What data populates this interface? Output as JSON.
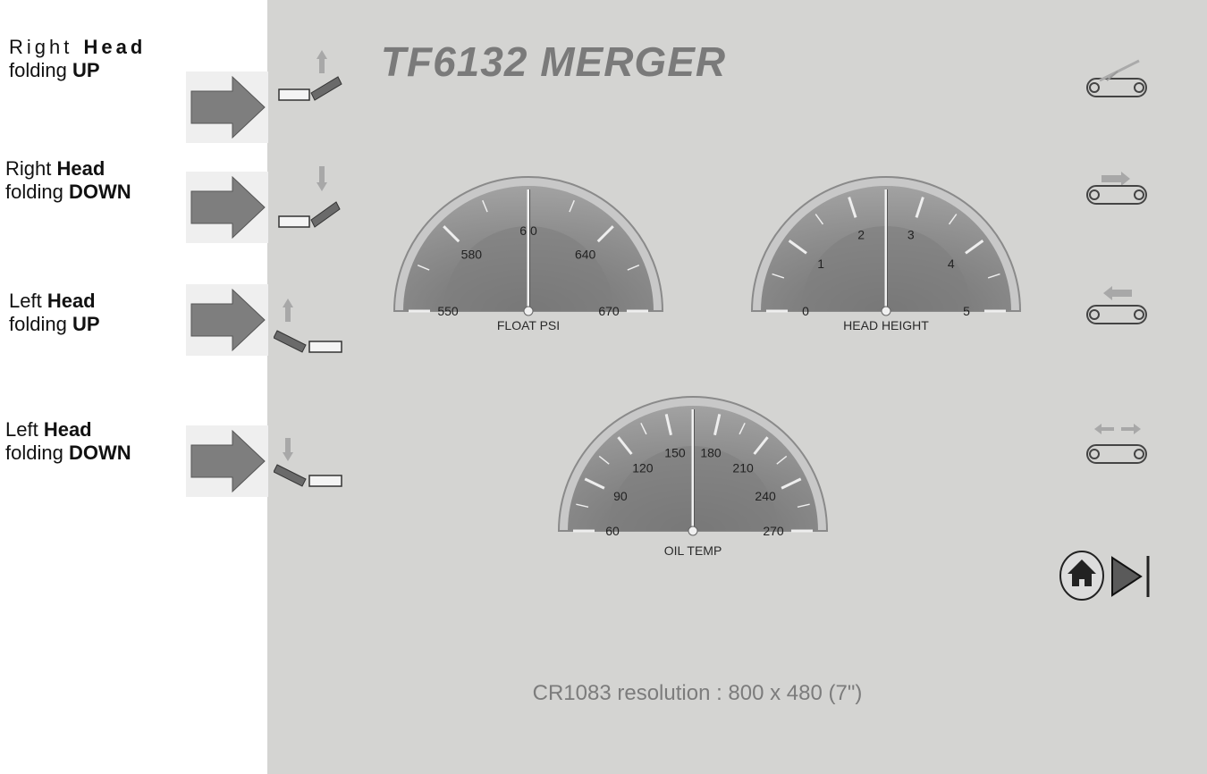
{
  "legend": [
    {
      "lead": "Right",
      "bold": "Head",
      "line2": "folding",
      "bold2": "UP"
    },
    {
      "lead": "Right",
      "bold": "Head",
      "line2": "folding",
      "bold2": "DOWN"
    },
    {
      "lead": "Left",
      "bold": "Head",
      "line2": "folding",
      "bold2": "UP"
    },
    {
      "lead": "Left",
      "bold": "Head",
      "line2": "folding",
      "bold2": "DOWN"
    }
  ],
  "screen": {
    "title": "TF6132 MERGER",
    "footer": "CR1083 resolution : 800 x 480 (7\")"
  },
  "gauges": [
    {
      "label": "FLOAT PSI",
      "ticks": [
        "550",
        "580",
        "6 0",
        "640",
        "670"
      ],
      "value_fraction": 0.5
    },
    {
      "label": "HEAD HEIGHT",
      "ticks": [
        "0",
        "1",
        "2",
        "3",
        "4",
        "5"
      ],
      "value_fraction": 0.5
    },
    {
      "label": "OIL TEMP",
      "ticks": [
        "60",
        "90",
        "120",
        "150",
        "180",
        "210",
        "240",
        "270"
      ],
      "value_fraction": 0.5
    }
  ],
  "icons": {
    "left": [
      "right-head-up-icon",
      "right-head-down-icon",
      "left-head-up-icon",
      "left-head-down-icon"
    ],
    "right": [
      "belt-tilt-icon",
      "belt-forward-icon",
      "belt-reverse-icon",
      "belt-spread-icon"
    ],
    "nav": [
      "home-icon",
      "next-page-icon"
    ]
  },
  "colors": {
    "background": "#d4d4d2",
    "title": "#7a7a7a",
    "gauge_face": "#9a9a9a"
  }
}
